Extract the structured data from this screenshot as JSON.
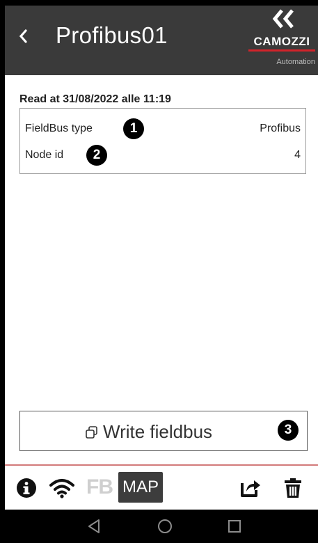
{
  "header": {
    "back_label": "‹",
    "title": "Profibus01",
    "logo": {
      "word": "CAMOZZI",
      "sub": "Automation",
      "accent": "#d2232a"
    }
  },
  "content": {
    "read_at": "Read at 31/08/2022 alle 11:19",
    "rows": [
      {
        "label": "FieldBus type",
        "value": "Profibus",
        "badge": "1"
      },
      {
        "label": "Node id",
        "value": "4",
        "badge": "2"
      }
    ],
    "write_button": {
      "label": "Write fieldbus",
      "badge": "3",
      "icon": "copy-icon"
    }
  },
  "toolbar": {
    "info_icon": "info-icon",
    "wifi_icon": "wifi-icon",
    "fb_label": "FB",
    "map_label": "MAP",
    "share_icon": "share-icon",
    "delete_icon": "trash-icon"
  },
  "navbar": {
    "back": "back-triangle-icon",
    "home": "home-circle-icon",
    "recents": "recents-square-icon"
  },
  "colors": {
    "header_bg": "#3a3a3a",
    "divider": "#d27a7a",
    "map_bg": "#3d3d3d"
  }
}
